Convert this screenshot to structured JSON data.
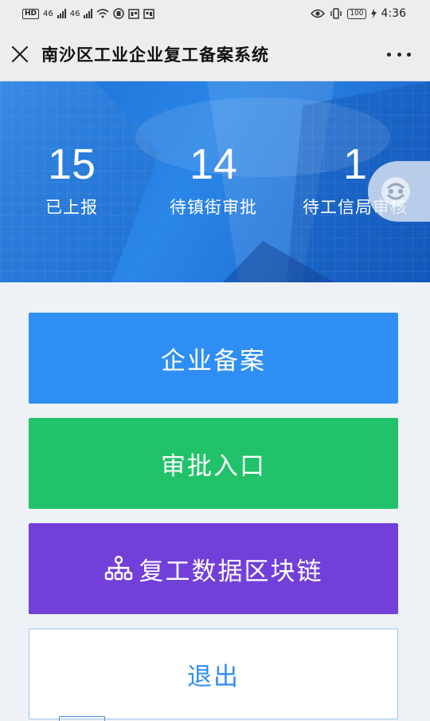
{
  "status_bar": {
    "left_chips": [
      "HD",
      "46",
      "46"
    ],
    "battery": "100",
    "time": "4:36"
  },
  "nav": {
    "title": "南沙区工业企业复工备案系统"
  },
  "stats": [
    {
      "value": "15",
      "label": "已上报"
    },
    {
      "value": "14",
      "label": "待镇街审批"
    },
    {
      "value": "1",
      "label": "待工信局审核"
    }
  ],
  "buttons": {
    "record": "企业备案",
    "approve": "审批入口",
    "chain": "复工数据区块链",
    "exit": "退出"
  },
  "colors": {
    "record": "#2f8ef3",
    "approve": "#22c26a",
    "chain": "#7240d8",
    "banner": "#1e6fd3"
  }
}
